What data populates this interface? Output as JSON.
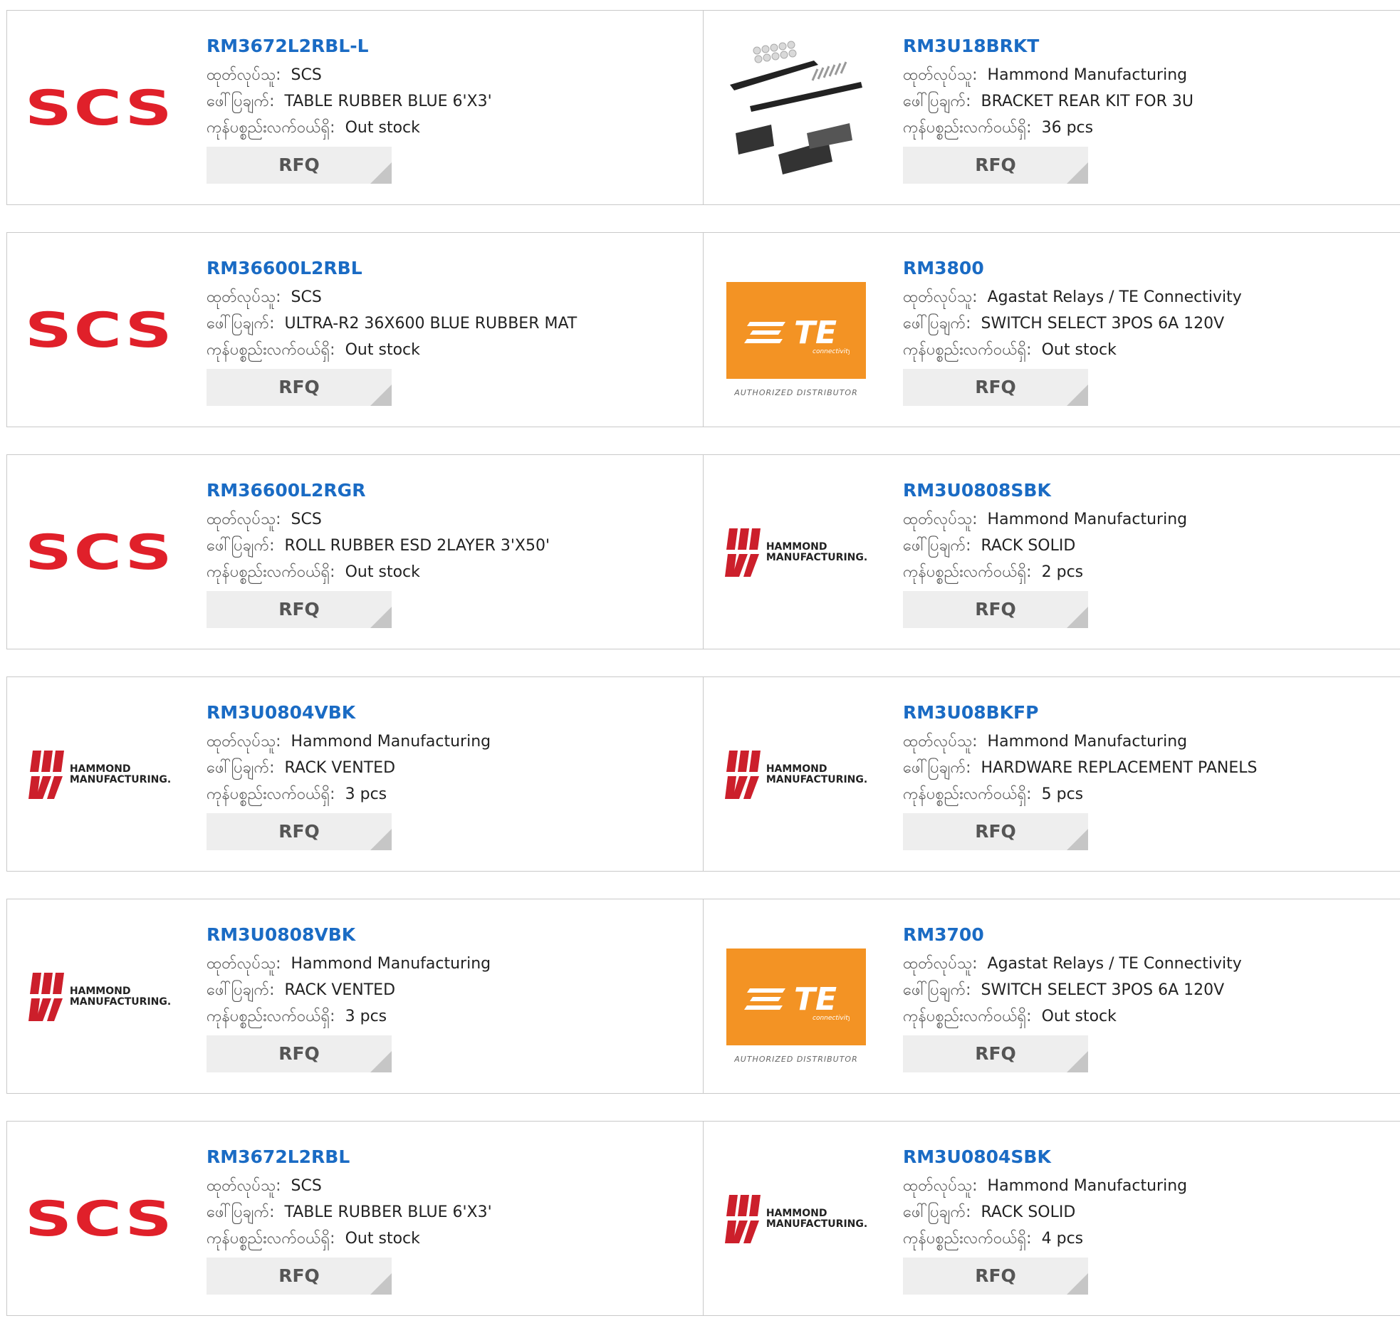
{
  "labels": {
    "manufacturer": "ထုတ်လုပ်သူ:",
    "description": "ဖေါ်ပြချက်:",
    "stock": "ကုန်ပစ္စည်းလက်ဝယ်ရှိ:",
    "rfq": "RFQ"
  },
  "logos": {
    "scs": "SCS",
    "te_main": "TE",
    "te_small": "connectivity",
    "te_authorized": "AUTHORIZED DISTRIBUTOR",
    "hammond_line1": "HAMMOND",
    "hammond_line2": "MANUFACTURING."
  },
  "colors": {
    "link": "#1a6bc4",
    "scs_red": "#e0202a",
    "te_orange": "#f39324",
    "hammond_red": "#cc1f2b"
  },
  "products": [
    {
      "part": "RM3672L2RBL-L",
      "manufacturer": "SCS",
      "description": "TABLE RUBBER BLUE 6'X3'",
      "stock": "Out stock",
      "logo": "scs"
    },
    {
      "part": "RM3U18BRKT",
      "manufacturer": "Hammond Manufacturing",
      "description": "BRACKET REAR KIT FOR 3U",
      "stock": "36 pcs",
      "logo": "bracket"
    },
    {
      "part": "RM36600L2RBL",
      "manufacturer": "SCS",
      "description": "ULTRA-R2 36X600 BLUE RUBBER MAT",
      "stock": "Out stock",
      "logo": "scs"
    },
    {
      "part": "RM3800",
      "manufacturer": "Agastat Relays / TE Connectivity",
      "description": "SWITCH SELECT 3POS 6A 120V",
      "stock": "Out stock",
      "logo": "te"
    },
    {
      "part": "RM36600L2RGR",
      "manufacturer": "SCS",
      "description": "ROLL RUBBER ESD 2LAYER 3'X50'",
      "stock": "Out stock",
      "logo": "scs"
    },
    {
      "part": "RM3U0808SBK",
      "manufacturer": "Hammond Manufacturing",
      "description": "RACK SOLID",
      "stock": "2 pcs",
      "logo": "hammond"
    },
    {
      "part": "RM3U0804VBK",
      "manufacturer": "Hammond Manufacturing",
      "description": "RACK VENTED",
      "stock": "3 pcs",
      "logo": "hammond"
    },
    {
      "part": "RM3U08BKFP",
      "manufacturer": "Hammond Manufacturing",
      "description": "HARDWARE REPLACEMENT PANELS",
      "stock": "5 pcs",
      "logo": "hammond"
    },
    {
      "part": "RM3U0808VBK",
      "manufacturer": "Hammond Manufacturing",
      "description": "RACK VENTED",
      "stock": "3 pcs",
      "logo": "hammond"
    },
    {
      "part": "RM3700",
      "manufacturer": "Agastat Relays / TE Connectivity",
      "description": "SWITCH SELECT 3POS 6A 120V",
      "stock": "Out stock",
      "logo": "te"
    },
    {
      "part": "RM3672L2RBL",
      "manufacturer": "SCS",
      "description": "TABLE RUBBER BLUE 6'X3'",
      "stock": "Out stock",
      "logo": "scs"
    },
    {
      "part": "RM3U0804SBK",
      "manufacturer": "Hammond Manufacturing",
      "description": "RACK SOLID",
      "stock": "4 pcs",
      "logo": "hammond"
    }
  ]
}
